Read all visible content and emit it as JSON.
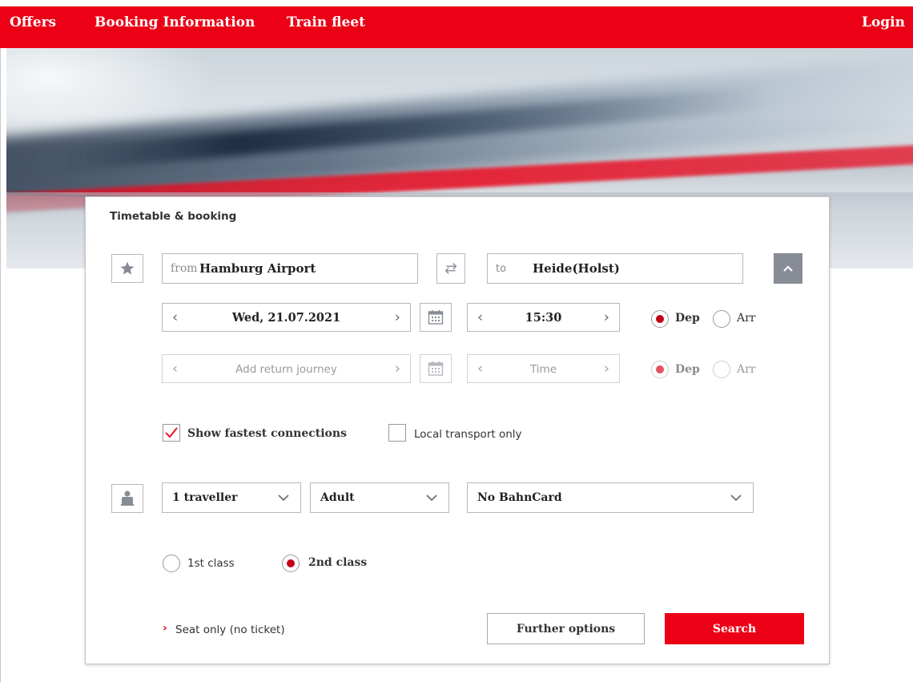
{
  "nav": {
    "offers": "Offers",
    "booking_information": "Booking Information",
    "train_fleet": "Train fleet",
    "login": "Login"
  },
  "panel": {
    "title": "Timetable & booking",
    "from_prefix": "from",
    "from_value": "Hamburg Airport",
    "to_prefix": "to",
    "to_value": "Heide(Holst)",
    "outbound": {
      "date": "Wed, 21.07.2021",
      "time": "15:30",
      "dep_label": "Dep",
      "arr_label": "Arr",
      "selected": "Dep"
    },
    "return": {
      "date_placeholder": "Add return journey",
      "time_placeholder": "Time",
      "dep_label": "Dep",
      "arr_label": "Arr",
      "selected": "Dep"
    },
    "options": {
      "fastest_label": "Show fastest connections",
      "fastest_checked": true,
      "local_label": "Local transport only",
      "local_checked": false
    },
    "travellers": {
      "count": "1 traveller",
      "type": "Adult",
      "bahncard": "No BahnCard"
    },
    "class": {
      "first_label": "1st class",
      "second_label": "2nd class",
      "selected": "2nd class"
    },
    "seat_only_label": "Seat only (no ticket)",
    "further_options_label": "Further options",
    "search_label": "Search"
  },
  "colors": {
    "brand_red": "#ec0016",
    "radio_red": "#c50014"
  },
  "icons": {
    "favorite": "star-icon",
    "swap": "swap-icon",
    "collapse": "chevron-up-icon",
    "calendar": "calendar-icon",
    "traveller": "person-icon"
  }
}
